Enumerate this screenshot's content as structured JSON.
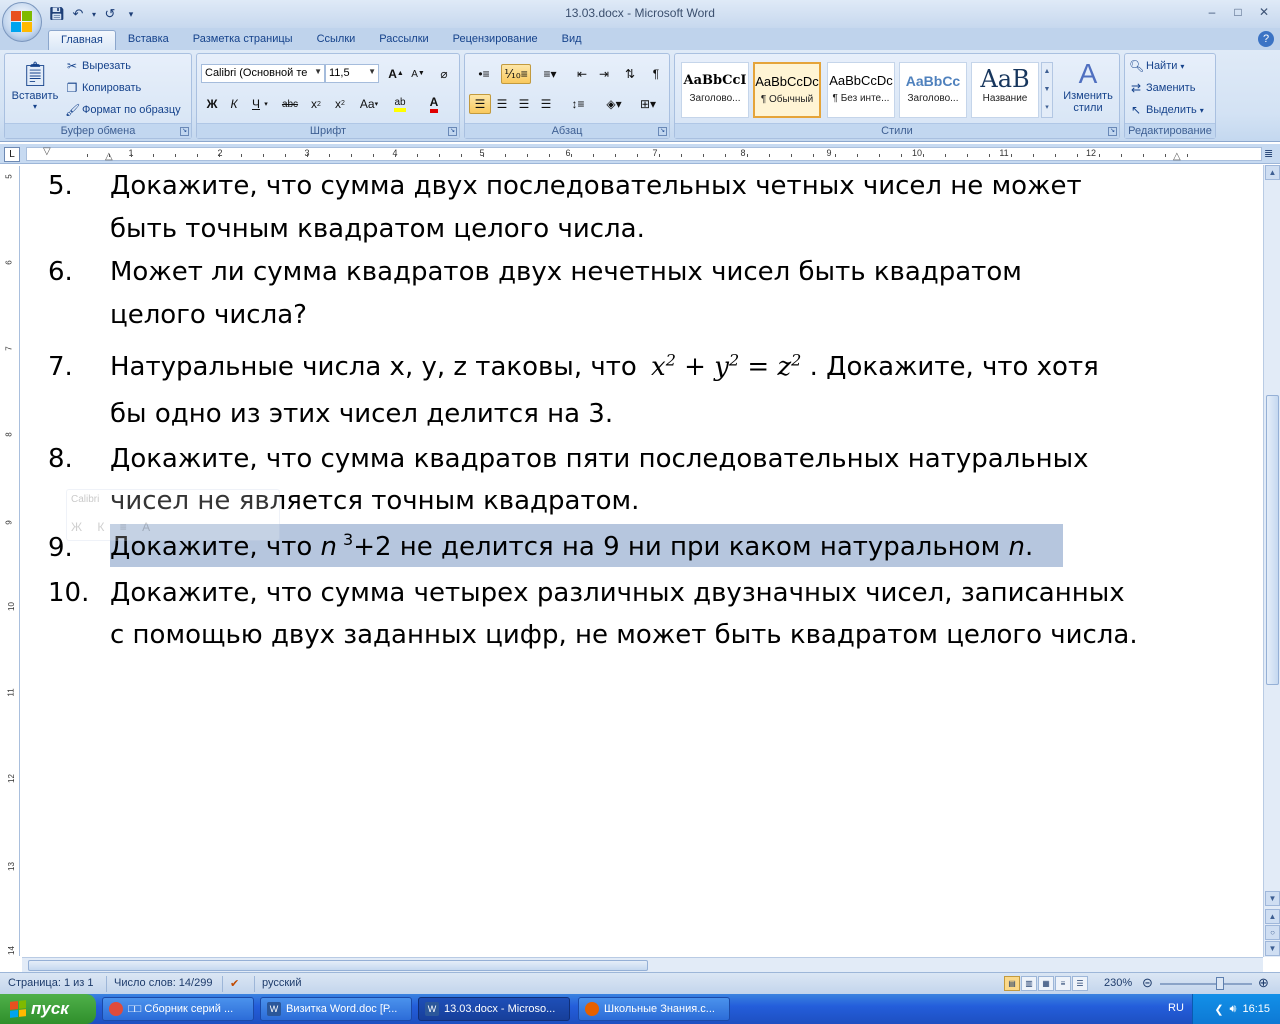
{
  "window": {
    "title": "13.03.docx - Microsoft Word",
    "minimize": "–",
    "maximize": "□",
    "close": "✕"
  },
  "tabs": [
    "Главная",
    "Вставка",
    "Разметка страницы",
    "Ссылки",
    "Рассылки",
    "Рецензирование",
    "Вид"
  ],
  "active_tab": "Главная",
  "ribbon": {
    "clipboard": {
      "label": "Буфер обмена",
      "paste": "Вставить",
      "cut": "Вырезать",
      "copy": "Копировать",
      "format_painter": "Формат по образцу"
    },
    "font": {
      "label": "Шрифт",
      "font_name": "Calibri (Основной те",
      "font_size": "11,5"
    },
    "paragraph": {
      "label": "Абзац"
    },
    "styles": {
      "label": "Стили",
      "tiles": [
        {
          "sample": "AaBbCcI",
          "name": "Заголово..."
        },
        {
          "sample": "AaBbCcDc",
          "name": "¶ Обычный"
        },
        {
          "sample": "AaBbCcDc",
          "name": "¶ Без инте..."
        },
        {
          "sample": "AaBbCc",
          "name": "Заголово..."
        },
        {
          "sample": "AaB",
          "name": "Название"
        }
      ],
      "change_styles": "Изменить стили"
    },
    "editing": {
      "label": "Редактирование",
      "find": "Найти",
      "replace": "Заменить",
      "select": "Выделить"
    }
  },
  "ruler": {
    "tab_selector": "L",
    "h_numbers": [
      "1",
      "1",
      "2",
      "3",
      "4",
      "5",
      "6",
      "7",
      "8",
      "9",
      "10",
      "11",
      "12"
    ],
    "v_numbers": [
      "5",
      "6",
      "7",
      "8",
      "9",
      "10",
      "11",
      "12",
      "13",
      "14"
    ]
  },
  "document": {
    "items": [
      {
        "num": "5.",
        "lines": [
          "Докажите, что сумма двух последовательных четных чисел не может",
          "быть точным квадратом целого числа."
        ]
      },
      {
        "num": "6.",
        "lines": [
          "Может ли сумма квадратов двух нечетных чисел быть квадратом",
          "целого числа?"
        ]
      },
      {
        "num": "7.",
        "line1_pre": "Натуральные числа x, y, z таковы, что",
        "line1_post": ". Докажите, что хотя",
        "line2": "бы одно из этих чисел делится на 3."
      },
      {
        "num": "8.",
        "lines": [
          "Докажите, что сумма квадратов пяти последовательных натуральных",
          "чисел не является точным квадратом."
        ]
      },
      {
        "num": "9.",
        "pre": "Докажите, что ",
        "var": "n",
        "exp": "3",
        "mid": "+2 не делится на 9 ни при каком натуральном ",
        "var2": "n",
        "end": "."
      },
      {
        "num": "10.",
        "lines": [
          "Докажите, что сумма четырех различных двузначных чисел, записанных",
          "с помощью двух заданных цифр, не может быть квадратом целого числа."
        ]
      }
    ],
    "formula": {
      "x": "x",
      "y": "y",
      "z": "z",
      "exp": "2",
      "plus": "+",
      "eq": "="
    }
  },
  "mini_toolbar": {
    "font": "Calibri",
    "buttons": "Ж К ≡ A"
  },
  "statusbar": {
    "page": "Страница: 1 из 1",
    "words": "Число слов: 14/299",
    "language": "русский",
    "zoom": "230%"
  },
  "taskbar": {
    "start": "пуск",
    "tasks": [
      {
        "label": "□□ Сборник серий ...",
        "color": "#e04b3c"
      },
      {
        "label": "Визитка Word.doc [Р...",
        "color": "#2b579a"
      },
      {
        "label": "13.03.docx - Microso...",
        "color": "#2b579a"
      },
      {
        "label": "Школьные Знания.с...",
        "color": "#e66000"
      }
    ],
    "lang": "RU",
    "clock": "16:15"
  }
}
